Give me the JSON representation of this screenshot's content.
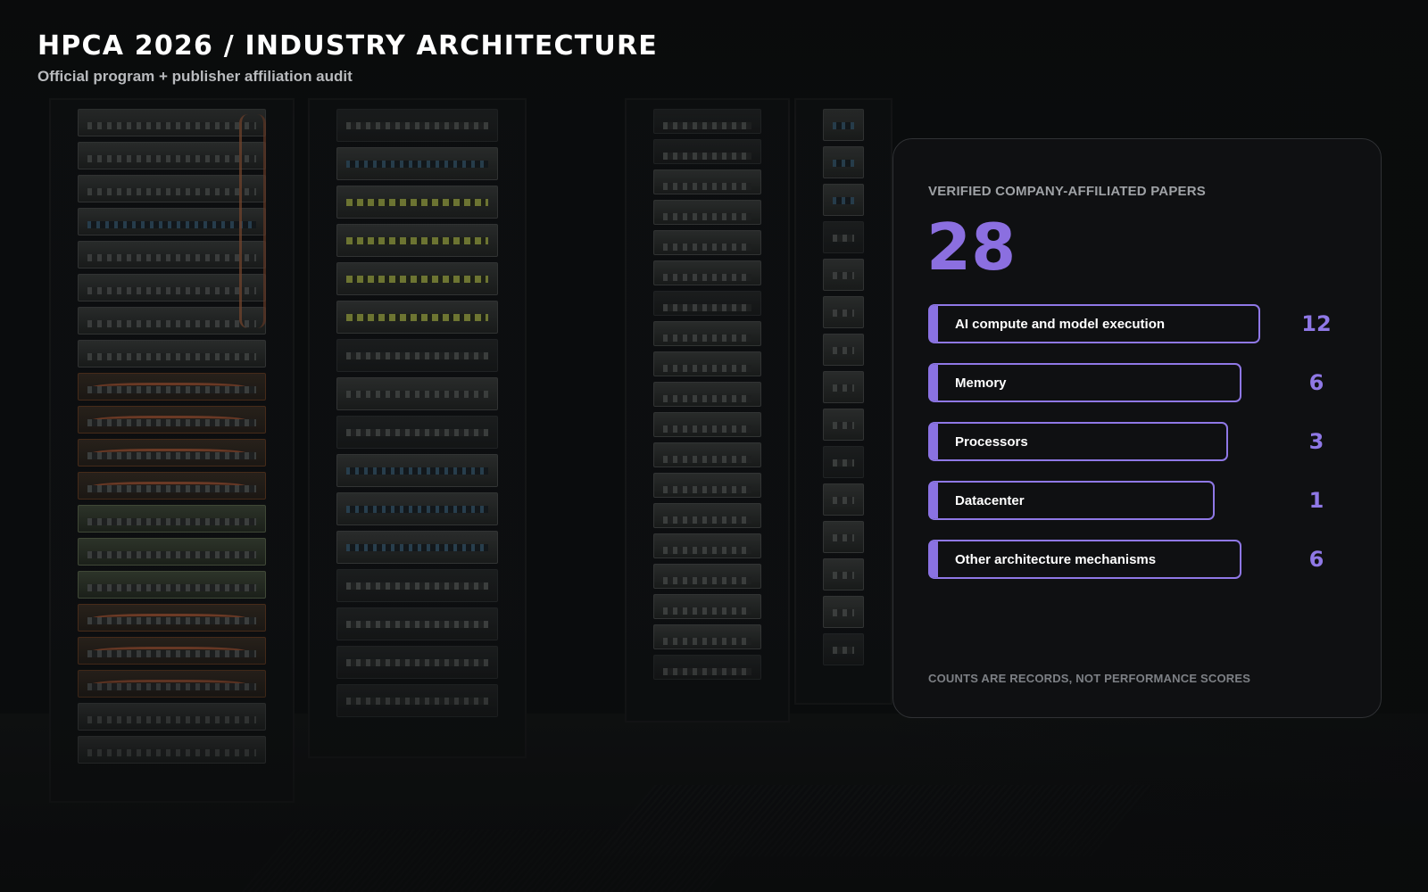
{
  "header": {
    "title": "HPCA 2026 / INDUSTRY ARCHITECTURE",
    "subtitle": "Official program + publisher affiliation audit"
  },
  "panel": {
    "kicker": "VERIFIED COMPANY-AFFILIATED PAPERS",
    "total": "28",
    "note": "COUNTS ARE RECORDS, NOT PERFORMANCE SCORES",
    "accent_color": "#8b6fe0"
  },
  "chart_data": {
    "type": "bar",
    "title": "VERIFIED COMPANY-AFFILIATED PAPERS",
    "categories": [
      "AI compute and model execution",
      "Memory",
      "Processors",
      "Datacenter",
      "Other architecture mechanisms"
    ],
    "values": [
      12,
      6,
      3,
      1,
      6
    ],
    "orientation": "horizontal",
    "total": 28
  }
}
